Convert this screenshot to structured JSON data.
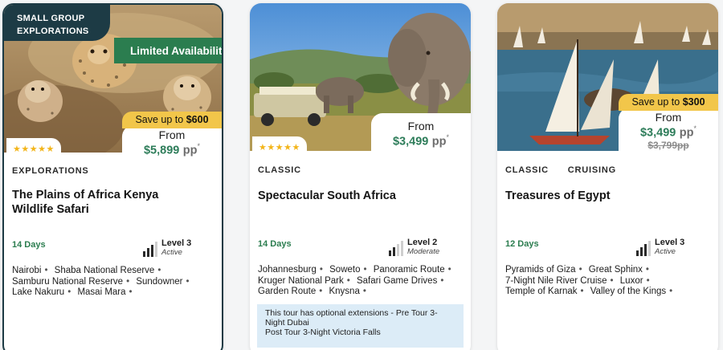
{
  "cards": [
    {
      "group_badge": "SMALL GROUP EXPLORATIONS",
      "ribbon": "Limited Availability",
      "rating_stars": 4.5,
      "stars_text": "★★★★★",
      "save_prefix": "Save up to",
      "save_amount": "$600",
      "from_label": "From",
      "price": "$5,899",
      "pp": "pp",
      "asterisk": "*",
      "types": [
        "EXPLORATIONS"
      ],
      "title": "The Plains of Africa Kenya Wildlife Safari",
      "days": "14 Days",
      "level": "Level 3",
      "level_desc": "Active",
      "level_value": 3,
      "places": [
        "Nairobi",
        "Shaba National Reserve",
        "Samburu National Reserve",
        "Sundowner",
        "Lake Nakuru",
        "Masai Mara"
      ],
      "image": "cheetahs-photo"
    },
    {
      "rating_stars": 4.5,
      "stars_text": "★★★★★",
      "from_label": "From",
      "price": "$3,499",
      "pp": "pp",
      "asterisk": "*",
      "types": [
        "CLASSIC"
      ],
      "title": "Spectacular South Africa",
      "days": "14 Days",
      "level": "Level 2",
      "level_desc": "Moderate",
      "level_value": 2,
      "places": [
        "Johannesburg",
        "Soweto",
        "Panoramic Route",
        "Kruger National Park",
        "Safari Game Drives",
        "Garden Route",
        "Knysna"
      ],
      "extension": "This tour has optional extensions - Pre Tour 3-Night Dubai\nPost Tour 3-Night Victoria Falls",
      "image": "elephants-photo"
    },
    {
      "save_prefix": "Save up to",
      "save_amount": "$300",
      "from_label": "From",
      "price": "$3,499",
      "pp": "pp",
      "asterisk": "*",
      "old_price": "$3,799pp",
      "types": [
        "CLASSIC",
        "CRUISING"
      ],
      "title": "Treasures of Egypt",
      "days": "12 Days",
      "level": "Level 3",
      "level_desc": "Active",
      "level_value": 3,
      "places": [
        "Pyramids of Giza",
        "Great Sphinx",
        "7-Night Nile River Cruise",
        "Luxor",
        "Temple of Karnak",
        "Valley of the Kings"
      ],
      "image": "nile-feluccas-photo"
    }
  ],
  "colors": {
    "accent_green": "#2e7d5a",
    "ribbon_green": "#2b7d4f",
    "dark_teal": "#1d3b45",
    "save_yellow": "#f2c64a",
    "star_gold": "#f3b51a",
    "extension_blue": "#dcecf7"
  }
}
